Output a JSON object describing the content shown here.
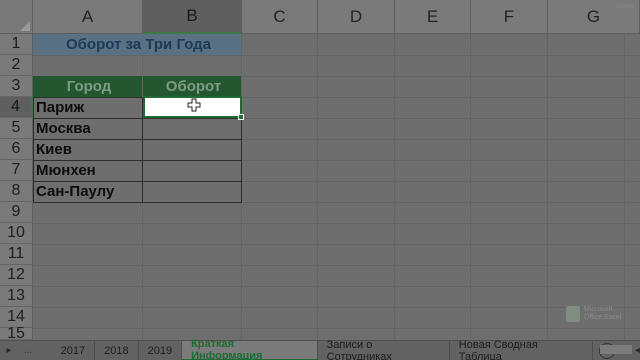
{
  "columns": [
    "A",
    "B",
    "C",
    "D",
    "E",
    "F",
    "G"
  ],
  "rows": [
    "1",
    "2",
    "3",
    "4",
    "5",
    "6",
    "7",
    "8",
    "9",
    "10",
    "11",
    "12",
    "13",
    "14",
    "15"
  ],
  "active_column": "B",
  "active_row": "4",
  "cells": {
    "title": "Оборот за Три Года",
    "header_city": "Город",
    "header_turnover": "Оборот",
    "cities": [
      "Париж",
      "Москва",
      "Киев",
      "Мюнхен",
      "Сан-Паулу"
    ]
  },
  "watermark": {
    "line1": "Microsoft",
    "line2": "Office Excel"
  },
  "corner_mark": "udemy",
  "sheet_tabs": [
    {
      "label": "2017",
      "active": false
    },
    {
      "label": "2018",
      "active": false
    },
    {
      "label": "2019",
      "active": false
    },
    {
      "label": "Краткая Информация",
      "active": true
    },
    {
      "label": "Записи о Сотрудниках",
      "active": false
    },
    {
      "label": "Новая Сводная Таблица",
      "active": false
    }
  ],
  "tab_controls": {
    "next": "▸",
    "more": "...",
    "add": "+",
    "scroll": "◂"
  },
  "colors": {
    "header_green": "#22572f",
    "title_fill": "#5a7183",
    "accent": "#1f6b33"
  }
}
